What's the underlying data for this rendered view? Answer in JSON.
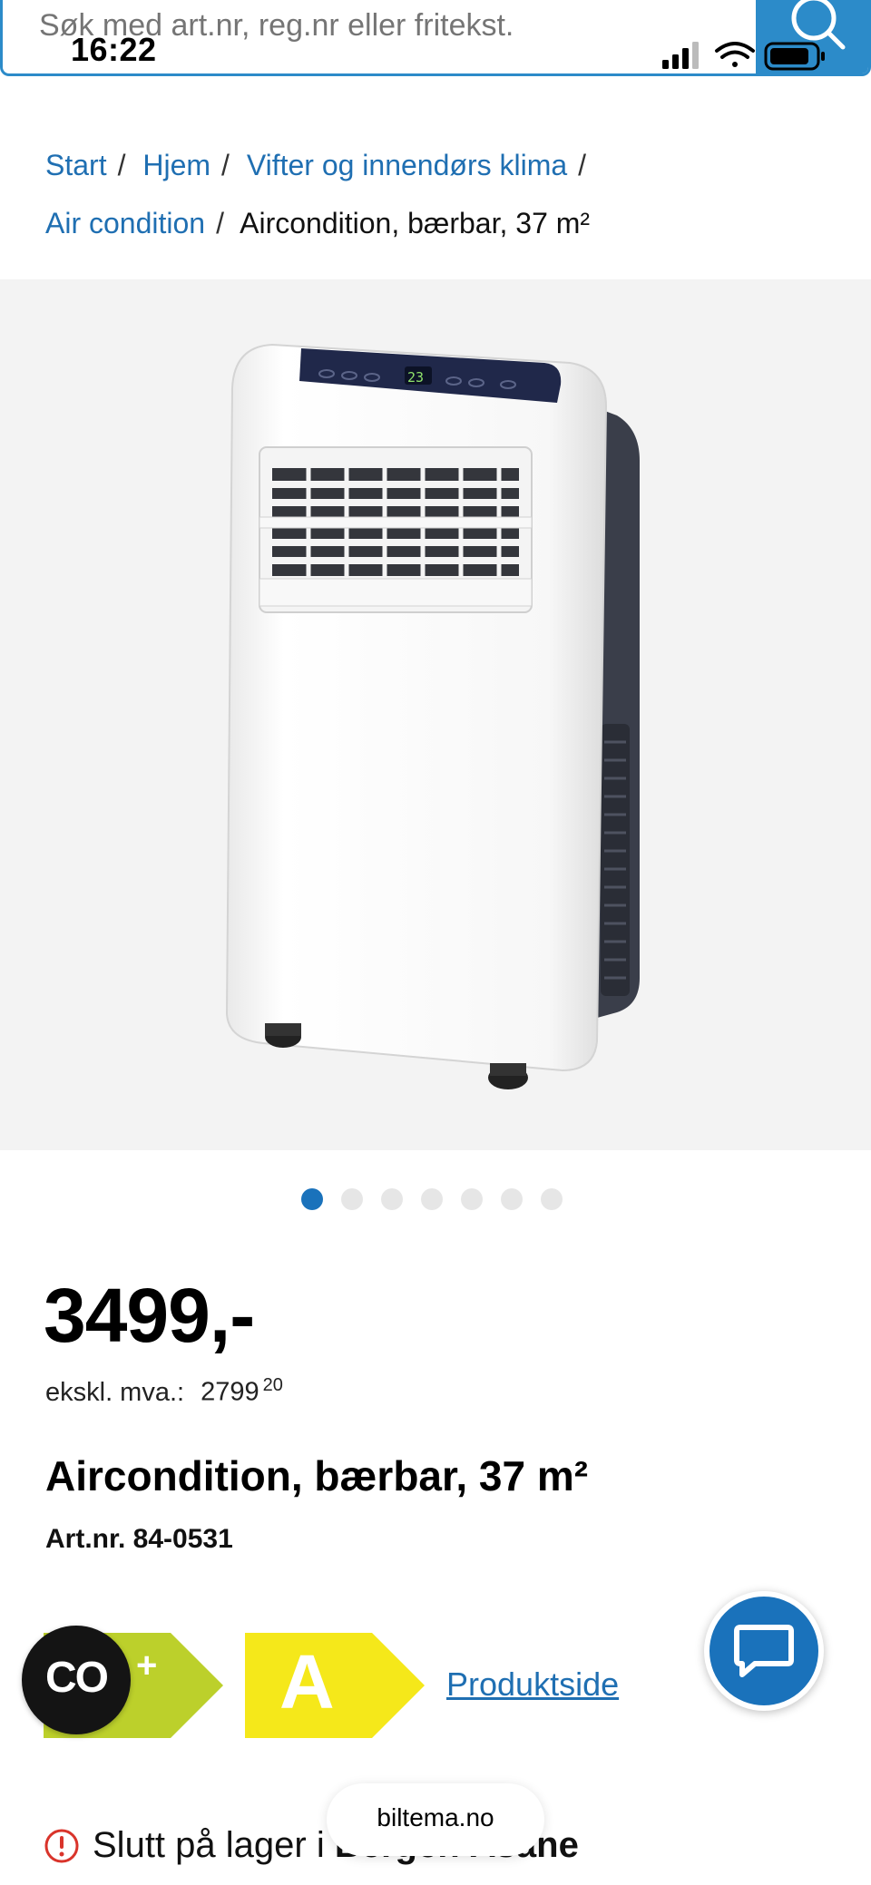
{
  "search": {
    "placeholder": "Søk med art.nr, reg.nr eller fritekst."
  },
  "status_bar": {
    "time": "16:22"
  },
  "breadcrumb": {
    "items": [
      "Start",
      "Hjem",
      "Vifter og innendørs klima",
      "Air condition"
    ],
    "separator": "/",
    "current": "Aircondition, bærbar, 37 m²"
  },
  "product_image": {
    "display_value": "23"
  },
  "carousel": {
    "dot_count": 7,
    "active_index": 0
  },
  "product": {
    "price": "3499,-",
    "ex_vat_label": "ekskl. mva.:",
    "ex_vat_value": "2799",
    "ex_vat_decimals": "20",
    "title": "Aircondition, bærbar, 37 m²",
    "art_nr": "Art.nr. 84-0531"
  },
  "energy": {
    "label_plus": "+",
    "rating": "A",
    "product_page_link": "Produktside",
    "colors": {
      "green": "#bcd02b",
      "yellow": "#f5e81a"
    }
  },
  "floating": {
    "co_label": "CO"
  },
  "stock": {
    "text": "Slutt på lager i",
    "store": "Bergen Åsane"
  },
  "browser": {
    "url": "biltema.no"
  },
  "colors": {
    "brand_blue": "#1a72bb",
    "link_blue": "#1f6fb2",
    "warning_red": "#d9342b"
  }
}
